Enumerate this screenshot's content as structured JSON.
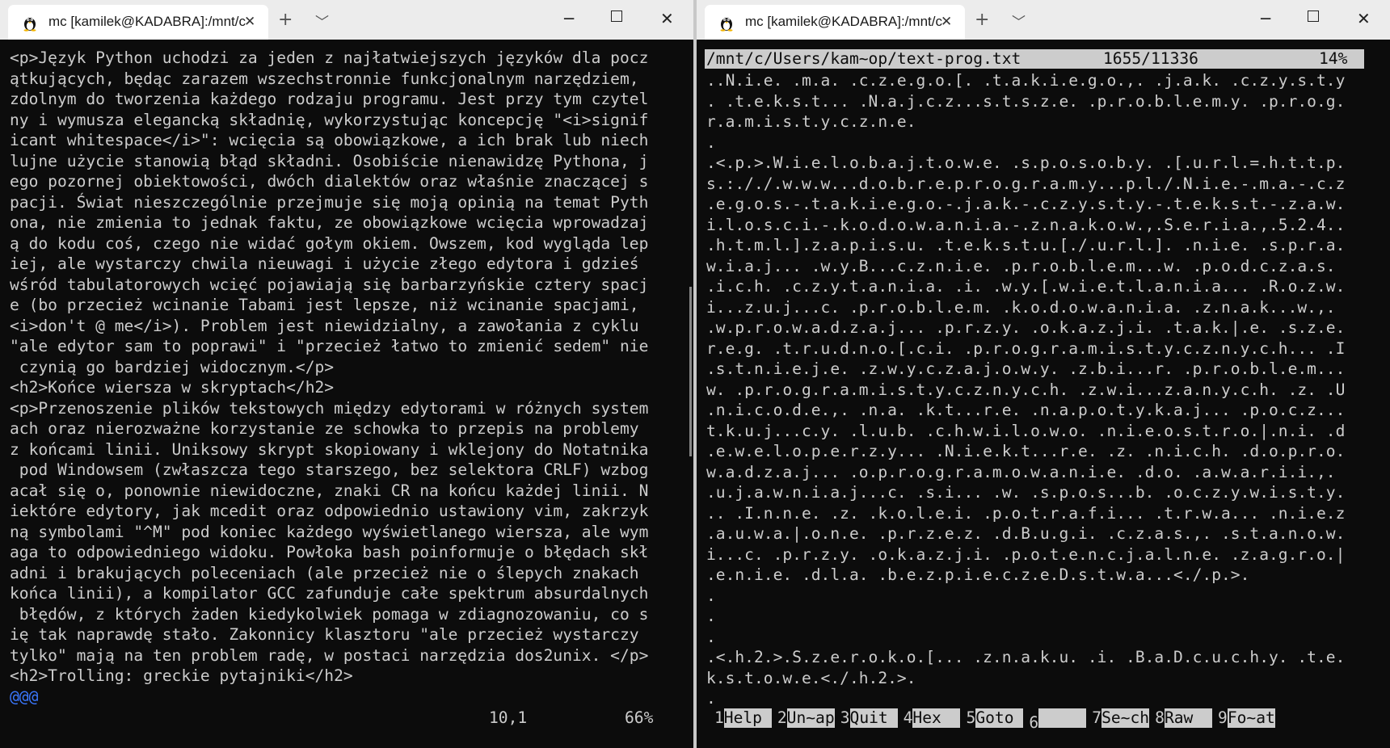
{
  "left_window": {
    "tab_title": "mc [kamilek@KADABRA]:/mnt/c",
    "tab_icon": "tux-icon",
    "new_tab": "+",
    "lines": [
      "<p>Język Python uchodzi za jeden z najłatwiejszych języków dla pocz",
      "ątkujących, będąc zarazem wszechstronnie funkcjonalnym narzędziem,",
      "zdolnym do tworzenia każdego rodzaju programu. Jest przy tym czytel",
      "ny i wymusza elegancką składnię, wykorzystując koncepcję \"<i>signif",
      "icant whitespace</i>\": wcięcia są obowiązkowe, a ich brak lub niech",
      "lujne użycie stanowią błąd składni. Osobiście nienawidzę Pythona, j",
      "ego pozornej obiektowości, dwóch dialektów oraz właśnie znaczącej s",
      "pacji. Świat nieszczególnie przejmuje się moją opinią na temat Pyth",
      "ona, nie zmienia to jednak faktu, ze obowiązkowe wcięcia wprowadzaj",
      "ą do kodu coś, czego nie widać gołym okiem. Owszem, kod wygląda lep",
      "iej, ale wystarczy chwila nieuwagi i użycie złego edytora i gdzieś",
      "wśród tabulatorowych wcięć pojawiają się barbarzyńskie cztery spacj",
      "e (bo przecież wcinanie Tabami jest lepsze, niż wcinanie spacjami,",
      "<i>don't @ me</i>). Problem jest niewidzialny, a zawołania z cyklu",
      "\"ale edytor sam to poprawi\" i \"przecież łatwo to zmienić sedem\" nie",
      " czynią go bardziej widocznym.</p>",
      "<h2>Końce wiersza w skryptach</h2>",
      "<p>Przenoszenie plików tekstowych między edytorami w różnych system",
      "ach oraz nierozważne korzystanie ze schowka to przepis na problemy",
      "z końcami linii. Uniksowy skrypt skopiowany i wklejony do Notatnika",
      " pod Windowsem (zwłaszcza tego starszego, bez selektora CRLF) wzbog",
      "acał się o, ponownie niewidoczne, znaki CR na końcu każdej linii. N",
      "iektóre edytory, jak mcedit oraz odpowiednio ustawiony vim, zakrzyk",
      "ną symbolami \"^M\" pod koniec każdego wyświetlanego wiersza, ale wym",
      "aga to odpowiedniego widoku. Powłoka bash poinformuje o błędach skł",
      "adni i brakujących poleceniach (ale przecież nie o ślepych znakach",
      "końca linii), a kompilator GCC zafunduje całe spektrum absurdalnych",
      " błędów, z których żaden kiedykolwiek pomaga w zdiagnozowaniu, co s",
      "ię tak naprawdę stało. Zakonnicy klasztoru \"ale przecież wystarczy",
      "tylko\" mają na ten problem radę, w postaci narzędzia dos2unix. </p>",
      "<h2>Trolling: greckie pytajniki</h2>"
    ],
    "tilde_line": "@@@",
    "cursor_pos": "10,1",
    "percent": "66%"
  },
  "right_window": {
    "tab_title": "mc [kamilek@KADABRA]:/mnt/c",
    "tab_icon": "tux-icon",
    "new_tab": "+",
    "header_path": "/mnt/c/Users/kam~op/text-prog.txt",
    "header_count": "1655/11336",
    "header_percent": "14%",
    "lines": [
      "..N.i.e. .m.a. .c.z.e.g.o.[. .t.a.k.i.e.g.o.,. .j.a.k. .c.z.y.s.t.y",
      ". .t.e.k.s.t... .N.a.j.c.z...s.t.s.z.e. .p.r.o.b.l.e.m.y. .p.r.o.g.",
      "r.a.m.i.s.t.y.c.z.n.e.",
      ".",
      ".<.p.>.W.i.e.l.o.b.a.j.t.o.w.e. .s.p.o.s.o.b.y. .[.u.r.l.=.h.t.t.p.",
      "s.:././.w.w.w...d.o.b.r.e.p.r.o.g.r.a.m.y...p.l./.N.i.e.-.m.a.-.c.z",
      ".e.g.o.s.-.t.a.k.i.e.g.o.-.j.a.k.-.c.z.y.s.t.y.-.t.e.k.s.t.-.z.a.w.",
      "i.l.o.s.c.i.-.k.o.d.o.w.a.n.i.a.-.z.n.a.k.o.w.,.S.e.r.i.a.,.5.2.4..",
      ".h.t.m.l.].z.a.p.i.s.u. .t.e.k.s.t.u.[./.u.r.l.]. .n.i.e. .s.p.r.a.",
      "w.i.a.j... .w.y.B...c.z.n.i.e. .p.r.o.b.l.e.m...w. .p.o.d.c.z.a.s.",
      ".i.c.h. .c.z.y.t.a.n.i.a. .i. .w.y.[.w.i.e.t.l.a.n.i.a... .R.o.z.w.",
      "i...z.u.j...c. .p.r.o.b.l.e.m. .k.o.d.o.w.a.n.i.a. .z.n.a.k...w.,.",
      ".w.p.r.o.w.a.d.z.a.j... .p.r.z.y. .o.k.a.z.j.i. .t.a.k.|.e. .s.z.e.",
      "r.e.g. .t.r.u.d.n.o.[.c.i. .p.r.o.g.r.a.m.i.s.t.y.c.z.n.y.c.h... .I",
      ".s.t.n.i.e.j.e. .z.w.y.c.z.a.j.o.w.y. .z.b.i...r. .p.r.o.b.l.e.m...",
      "w. .p.r.o.g.r.a.m.i.s.t.y.c.z.n.y.c.h. .z.w.i...z.a.n.y.c.h. .z. .U",
      ".n.i.c.o.d.e.,. .n.a. .k.t...r.e. .n.a.p.o.t.y.k.a.j... .p.o.c.z...",
      "t.k.u.j...c.y. .l.u.b. .c.h.w.i.l.o.w.o. .n.i.e.o.s.t.r.o.|.n.i. .d",
      ".e.w.e.l.o.p.e.r.z.y... .N.i.e.k.t...r.e. .z. .n.i.c.h. .d.o.p.r.o.",
      "w.a.d.z.a.j... .o.p.r.o.g.r.a.m.o.w.a.n.i.e. .d.o. .a.w.a.r.i.i.,.",
      ".u.j.a.w.n.i.a.j...c. .s.i... .w. .s.p.o.s...b. .o.c.z.y.w.i.s.t.y.",
      ".. .I.n.n.e. .z. .k.o.l.e.i. .p.o.t.r.a.f.i... .t.r.w.a... .n.i.e.z",
      ".a.u.w.a.|.o.n.e. .p.r.z.e.z. .d.B.u.g.i. .c.z.a.s.,. .s.t.a.n.o.w.",
      "i...c. .p.r.z.y. .o.k.a.z.j.i. .p.o.t.e.n.c.j.a.l.n.e. .z.a.g.r.o.|",
      ".e.n.i.e. .d.l.a. .b.e.z.p.i.e.c.z.e.D.s.t.w.a...<./.p.>.",
      ".",
      ".",
      ".",
      ".<.h.2.>.S.z.e.r.o.k.o.[... .z.n.a.k.u. .i. .B.a.D.c.u.c.h.y. .t.e.",
      "k.s.t.o.w.e.<./.h.2.>.",
      "."
    ],
    "fkeys": [
      {
        "num": "1",
        "label": "Help"
      },
      {
        "num": "2",
        "label": "Un~ap"
      },
      {
        "num": "3",
        "label": "Quit"
      },
      {
        "num": "4",
        "label": "Hex"
      },
      {
        "num": "5",
        "label": "Goto"
      },
      {
        "num": "6",
        "label": ""
      },
      {
        "num": "7",
        "label": "Se~ch"
      },
      {
        "num": "8",
        "label": "Raw"
      },
      {
        "num": "9",
        "label": "Fo~at"
      }
    ]
  },
  "colors": {
    "terminal_bg": "#0c0c0c",
    "terminal_fg": "#cccccc",
    "vim_tilde": "#3b78ff",
    "bar_bg": "#cccccc"
  }
}
